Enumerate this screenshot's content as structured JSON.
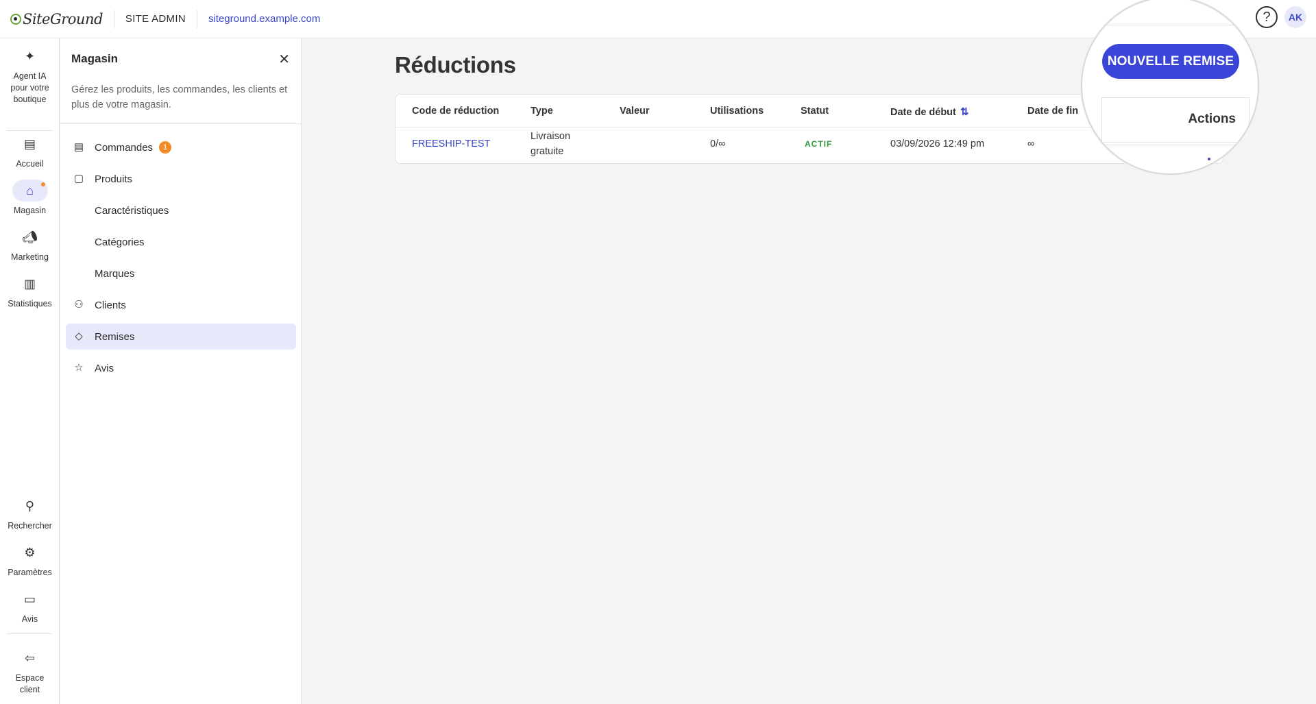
{
  "topbar": {
    "brand": "SiteGround",
    "section": "SITE ADMIN",
    "site_url": "siteground.example.com",
    "help_glyph": "?",
    "avatar_initials": "AK"
  },
  "rail": {
    "items": [
      {
        "label": "Agent IA pour votre boutique",
        "icon": "sparkles-icon"
      },
      {
        "label": "Accueil",
        "icon": "home-dashboard-icon"
      },
      {
        "label": "Magasin",
        "icon": "store-icon",
        "active": true
      },
      {
        "label": "Marketing",
        "icon": "megaphone-icon"
      },
      {
        "label": "Statistiques",
        "icon": "bar-chart-icon"
      },
      {
        "label": "Rechercher",
        "icon": "search-icon"
      },
      {
        "label": "Paramètres",
        "icon": "gear-icon"
      },
      {
        "label": "Avis",
        "icon": "feedback-icon"
      },
      {
        "label": "Espace client",
        "icon": "exit-icon"
      }
    ]
  },
  "subnav": {
    "title": "Magasin",
    "description": "Gérez les produits, les commandes, les clients et plus de votre magasin.",
    "items": [
      {
        "label": "Commandes",
        "icon": "receipt-icon",
        "badge": "1"
      },
      {
        "label": "Produits",
        "icon": "bag-icon"
      },
      {
        "label": "Caractéristiques"
      },
      {
        "label": "Catégories"
      },
      {
        "label": "Marques"
      },
      {
        "label": "Clients",
        "icon": "people-icon"
      },
      {
        "label": "Remises",
        "icon": "tag-icon",
        "active": true
      },
      {
        "label": "Avis",
        "icon": "star-icon"
      }
    ]
  },
  "main": {
    "title": "Réductions",
    "table": {
      "headers": [
        "Code de réduction",
        "Type",
        "Valeur",
        "Utilisations",
        "Statut",
        "Date de début",
        "Date de fin"
      ],
      "rows": [
        {
          "code": "FREESHIP-TEST",
          "type_line1": "Livraison",
          "type_line2": "gratuite",
          "value": "",
          "uses": "0/∞",
          "status": "ACTIF",
          "start": "03/09/2026 12:49 pm",
          "end": "∞"
        }
      ]
    }
  },
  "magnifier": {
    "new_button": "NOUVELLE REMISE",
    "actions_header": "Actions"
  },
  "colors": {
    "accent": "#3a45d8",
    "link": "#3a45c8",
    "badge": "#f28c28",
    "status_active": "#2e9a3c",
    "active_bg": "#e7e9fb"
  }
}
